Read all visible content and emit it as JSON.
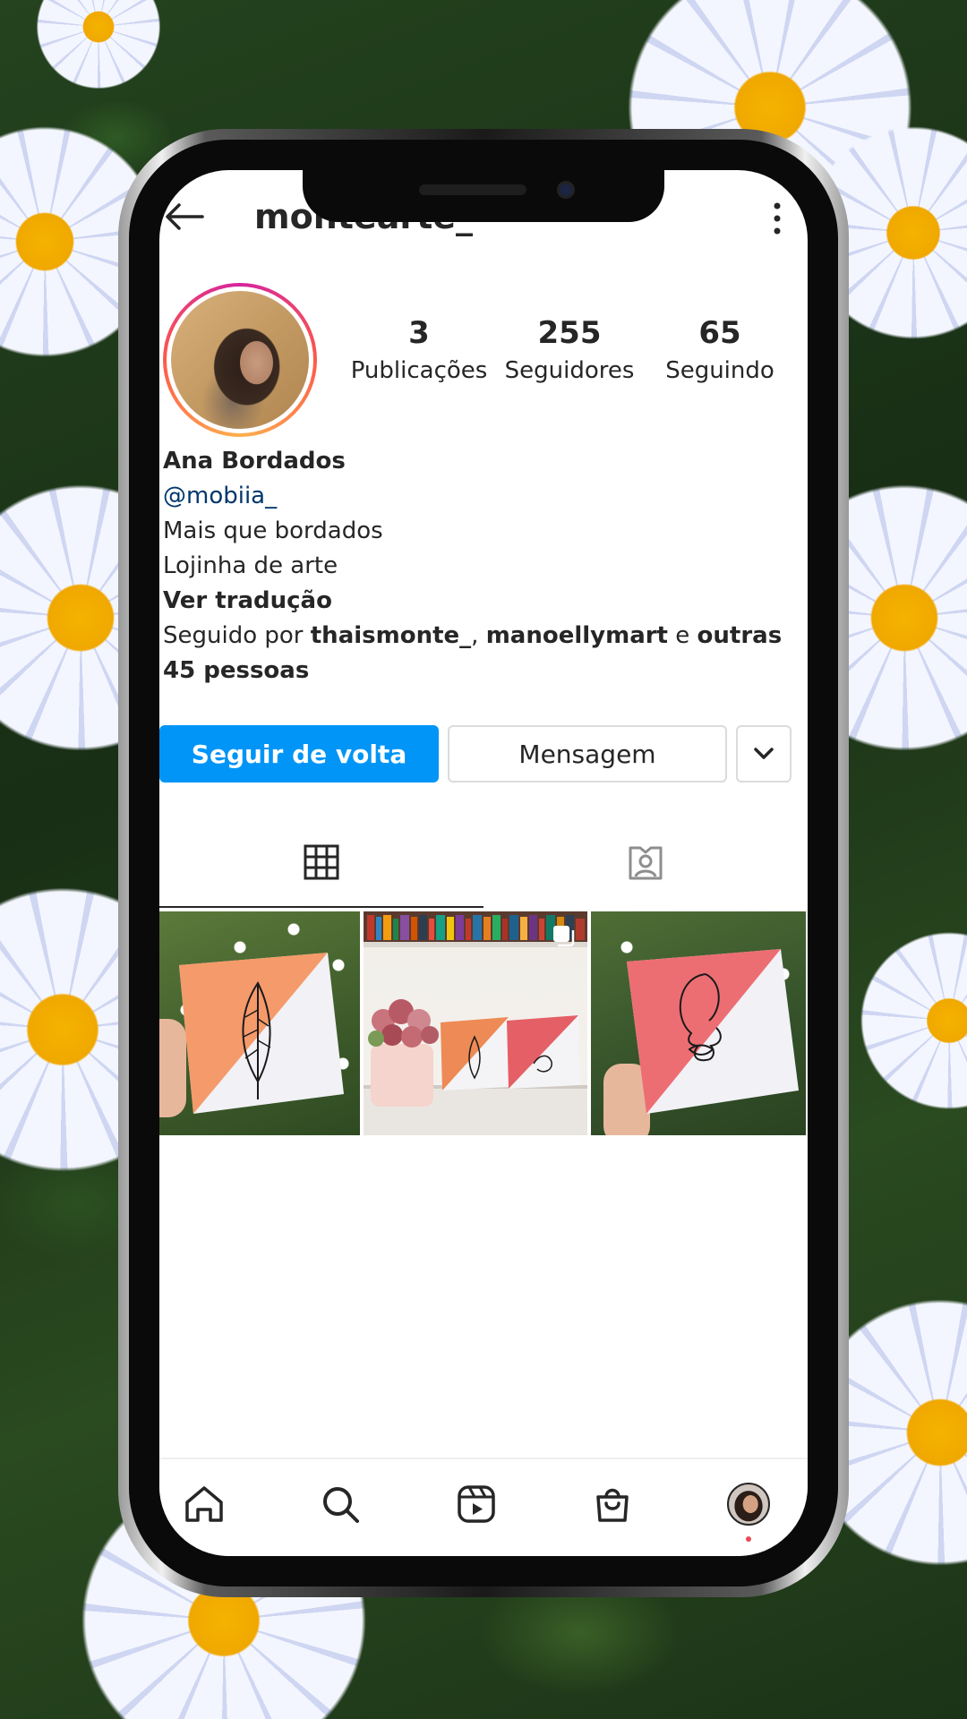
{
  "header": {
    "username": "montearte_"
  },
  "profile": {
    "stats": [
      {
        "value": "3",
        "label": "Publicações"
      },
      {
        "value": "255",
        "label": "Seguidores"
      },
      {
        "value": "65",
        "label": "Seguindo"
      }
    ],
    "name": "Ana Bordados",
    "mention": "@mobiia_",
    "bio_lines": [
      "Mais que bordados",
      "Lojinha de arte"
    ],
    "translate": "Ver tradução",
    "followed_by": {
      "prefix": "Seguido por ",
      "user1": "thaismonte_",
      "sep": ", ",
      "user2": "manoellymart",
      "and": " e ",
      "others": "outras 45 pessoas"
    }
  },
  "actions": {
    "follow_back": "Seguir de volta",
    "message": "Mensagem"
  },
  "tabs": {
    "grid": "grid-icon",
    "tagged": "tagged-icon"
  },
  "posts": [
    {
      "name": "post-1",
      "desc": "orange-white card with leaf line art"
    },
    {
      "name": "post-2",
      "desc": "shelf with roses and two cards",
      "multi": true
    },
    {
      "name": "post-3",
      "desc": "pink-white card with face line art"
    }
  ],
  "bottom_nav": [
    "home-icon",
    "search-icon",
    "reels-icon",
    "shop-icon",
    "profile-avatar"
  ],
  "colors": {
    "primary_button": "#0095f6",
    "text": "#262626",
    "link": "#00376b",
    "notification_dot": "#ed4956"
  }
}
